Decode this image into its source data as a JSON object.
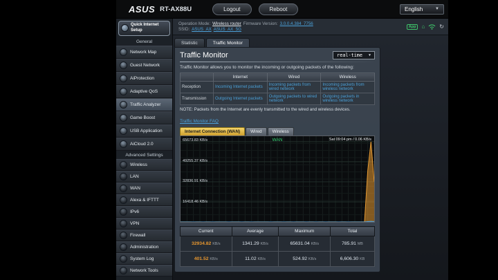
{
  "header": {
    "brand": "ASUS",
    "model": "RT-AX88U",
    "logout": "Logout",
    "reboot": "Reboot",
    "language": "English"
  },
  "infobar": {
    "op_label": "Operation Mode:",
    "op_value": "Wireless router",
    "fw_label": "Firmware Version:",
    "fw_value": "3.0.0.4.384_7756",
    "ssid_label": "SSID:",
    "ssid1": "ASUS_AX",
    "ssid2": "ASUS_AX_5G",
    "app_label": "App"
  },
  "tabs": {
    "statistic": "Statistic",
    "traffic_monitor": "Traffic Monitor"
  },
  "sidebar": {
    "qis1": "Quick Internet",
    "qis2": "Setup",
    "general_title": "General",
    "general": [
      "Network Map",
      "Guest Network",
      "AiProtection",
      "Adaptive QoS",
      "Traffic Analyzer",
      "Game Boost",
      "USB Application",
      "AiCloud 2.0"
    ],
    "advanced_title": "Advanced Settings",
    "advanced": [
      "Wireless",
      "LAN",
      "WAN",
      "Alexa & IFTTT",
      "IPv6",
      "VPN",
      "Firewall",
      "Administration",
      "System Log",
      "Network Tools"
    ]
  },
  "main": {
    "title": "Traffic Monitor",
    "mode": "real-time",
    "intro": "Traffic Monitor allows you to monitor the incoming or outgoing packets of the following:",
    "matrix": {
      "headers": [
        "Internet",
        "Wired",
        "Wireless"
      ],
      "row1_label": "Reception",
      "row1": [
        "Incoming Internet packets",
        "Incoming packets from wired network",
        "Incoming packets from wireless network"
      ],
      "row2_label": "Transmission",
      "row2": [
        "Outgoing Internet packets",
        "Outgoing packets to wired network",
        "Outgoing packets in wireless network"
      ]
    },
    "note": "NOTE: Packets from the Internet are evenly transmitted to the wired and wireless devices.",
    "faq": "Traffic Monitor FAQ",
    "chart_tabs": [
      "Internet Connection (WAN)",
      "Wired",
      "Wireless"
    ]
  },
  "chart_data": {
    "type": "area",
    "title": "WAN",
    "timestamp": "Sat 09:04 pm / 0.06 KB/s",
    "ylabels": [
      "65673.83 KB/s",
      "49255.37 KB/s",
      "32836.91 KB/s",
      "16418.46 KB/s"
    ],
    "ymax": 65673.83,
    "ylim": [
      0,
      65673.83
    ],
    "grid": true,
    "legend_position": "none",
    "series": [
      {
        "name": "Reception",
        "color": "#e89b32",
        "fill": "rgba(232,155,50,0.55)",
        "values": [
          35,
          28,
          40,
          32,
          25,
          38,
          30,
          26,
          42,
          33,
          27,
          36,
          29,
          44,
          31,
          25,
          39,
          28,
          34,
          26,
          41,
          30,
          24,
          37,
          32,
          28,
          45,
          33,
          26,
          38,
          29,
          35,
          27,
          43,
          31,
          24,
          40,
          28,
          33,
          26,
          36,
          30,
          25,
          42,
          34,
          27,
          39,
          29,
          32,
          25,
          44,
          31,
          26,
          37,
          30,
          28,
          60,
          150,
          42000,
          65631.04,
          32934.82
        ]
      },
      {
        "name": "Transmission",
        "color": "#4fa3e3",
        "fill": "rgba(79,163,227,0.45)",
        "values": [
          4,
          3,
          5,
          4,
          3,
          6,
          4,
          3,
          5,
          4,
          6,
          3,
          4,
          5,
          3,
          4,
          6,
          4,
          3,
          5,
          4,
          3,
          6,
          4,
          5,
          3,
          4,
          6,
          3,
          4,
          5,
          4,
          3,
          6,
          4,
          3,
          5,
          4,
          6,
          3,
          4,
          5,
          3,
          4,
          6,
          4,
          3,
          5,
          4,
          3,
          6,
          4,
          5,
          3,
          4,
          6,
          5,
          20,
          300,
          524.92,
          401.52
        ]
      }
    ]
  },
  "stats": {
    "headers": [
      "Current",
      "Average",
      "Maximum",
      "Total"
    ],
    "rows": [
      {
        "current": "32934.82",
        "current_unit": "KB/s",
        "average": "1341.29",
        "average_unit": "KB/s",
        "maximum": "65631.04",
        "maximum_unit": "KB/s",
        "total": "785.91",
        "total_unit": "MB"
      },
      {
        "current": "401.52",
        "current_unit": "KB/s",
        "average": "11.02",
        "average_unit": "KB/s",
        "maximum": "524.92",
        "maximum_unit": "KB/s",
        "total": "6,606.30",
        "total_unit": "KB"
      }
    ]
  }
}
